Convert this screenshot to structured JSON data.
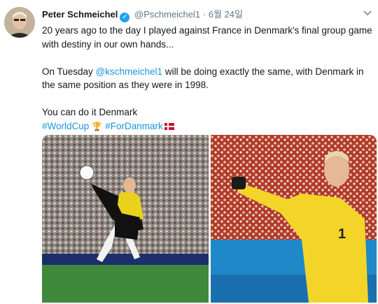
{
  "tweet": {
    "display_name": "Peter Schmeichel",
    "handle": "@Pschmeichel1",
    "separator": "·",
    "date": "6월 24일",
    "lines": [
      "20 years ago to the day I played against France in Denmark's final group game with destiny in our own hands...",
      "",
      "will be doing exactly the same, with Denmark in the same position as they were in 1998.",
      "",
      "You can do it Denmark"
    ],
    "line2_prefix": "On Tuesday",
    "mention": "@kschmeichel1",
    "hashtags": [
      "#WorldCup",
      "#ForDanmark"
    ]
  },
  "icons": {
    "verified": "verified-badge-icon",
    "menu": "chevron-down-icon",
    "trophy": "trophy-emoji-icon",
    "flag": "denmark-flag-emoji-icon"
  },
  "colors": {
    "link": "#1b95e0",
    "verified": "#1da1f2",
    "muted": "#657786"
  }
}
